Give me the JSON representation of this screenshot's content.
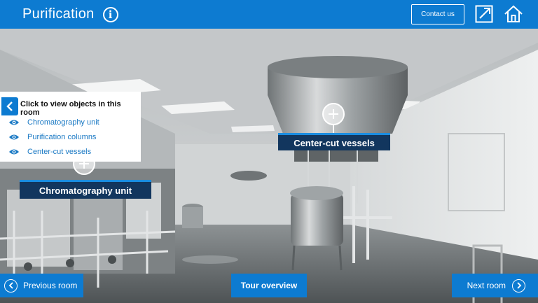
{
  "header": {
    "title": "Purification",
    "info_icon": "info-icon",
    "contact_label": "Contact us",
    "fullscreen_icon": "expand-icon",
    "home_icon": "home-icon",
    "accent": "#0d7bd1"
  },
  "scene": {
    "hotspots": [
      {
        "label": "Center-cut vessels"
      },
      {
        "label": "Chromatography unit"
      }
    ]
  },
  "panel": {
    "heading": "Click to view objects in this room",
    "collapse_icon": "chevron-left-icon",
    "items": [
      {
        "label": "Chromatography unit",
        "icon": "eye-icon"
      },
      {
        "label": "Purification columns",
        "icon": "eye-icon"
      },
      {
        "label": "Center-cut vessels",
        "icon": "eye-icon"
      }
    ]
  },
  "footer": {
    "prev_label": "Previous room",
    "tour_label": "Tour overview",
    "next_label": "Next room"
  }
}
